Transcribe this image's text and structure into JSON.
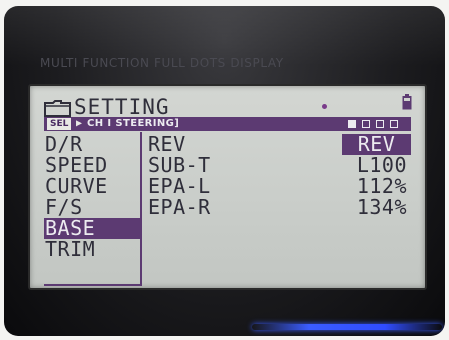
{
  "device": {
    "bezel_caption": "MULTI FUNCTION FULL DOTS DISPLAY"
  },
  "screen": {
    "title": "SETTING",
    "header": {
      "sel_tag": "SEL",
      "arrow": "▶",
      "channel": "CH I STEERING]"
    },
    "menu": [
      {
        "label": "D/R",
        "selected": false
      },
      {
        "label": "SPEED",
        "selected": false
      },
      {
        "label": "CURVE",
        "selected": false
      },
      {
        "label": "F/S",
        "selected": false
      },
      {
        "label": "BASE",
        "selected": true
      },
      {
        "label": "TRIM",
        "selected": false
      }
    ],
    "params": [
      {
        "name": "REV",
        "value": "REV",
        "highlight": true
      },
      {
        "name": "SUB-T",
        "value": "L100",
        "highlight": false
      },
      {
        "name": "EPA-L",
        "value": "112%",
        "highlight": false
      },
      {
        "name": "EPA-R",
        "value": "134%",
        "highlight": false
      }
    ],
    "page_indicator": {
      "total": 4,
      "current": 1
    }
  },
  "colors": {
    "lcd_background": "#cfd2ce",
    "lcd_ink": "#2f2e3a",
    "highlight": "#5c3a72",
    "accent_led": "#3a5cff"
  },
  "icons": {
    "title_icon": "folder-icon",
    "status_icon": "battery-icon"
  }
}
